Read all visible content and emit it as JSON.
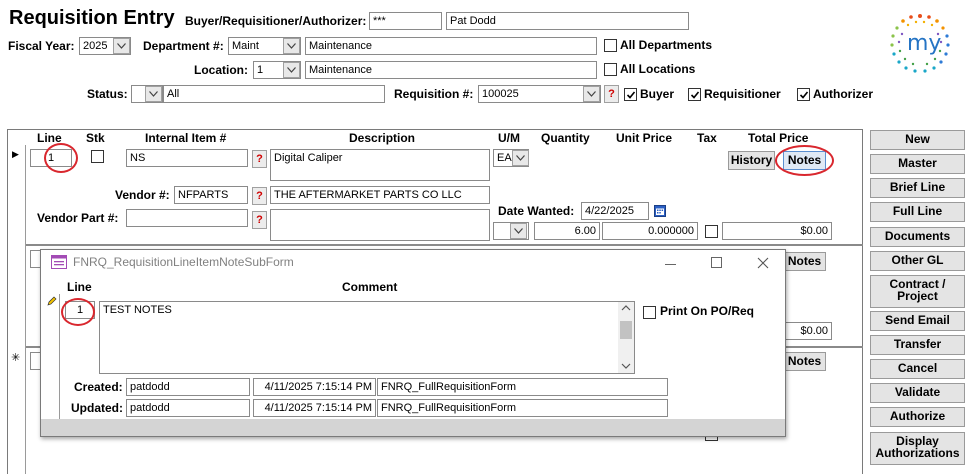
{
  "header": {
    "title": "Requisition Entry",
    "buyer_label": "Buyer/Requisitioner/Authorizer:",
    "buyer_code": "***",
    "buyer_name": "Pat Dodd",
    "fiscal_year_label": "Fiscal Year:",
    "fiscal_year": "2025",
    "department_label": "Department #:",
    "department_code": "Maint",
    "department_name": "Maintenance",
    "all_departments_label": "All Departments",
    "location_label": "Location:",
    "location_code": "1",
    "location_name": "Maintenance",
    "all_locations_label": "All Locations",
    "status_label": "Status:",
    "status_value": "All",
    "requisition_label": "Requisition #:",
    "requisition_value": "100025",
    "buyer_check_label": "Buyer",
    "requisitioner_check_label": "Requisitioner",
    "authorizer_check_label": "Authorizer"
  },
  "grid": {
    "columns": {
      "line": "Line",
      "stk": "Stk",
      "internal_item": "Internal Item #",
      "description": "Description",
      "um": "U/M",
      "quantity": "Quantity",
      "unit_price": "Unit Price",
      "tax": "Tax",
      "total_price": "Total Price"
    },
    "row": {
      "line": "1",
      "item": "NS",
      "description": "Digital Caliper",
      "um": "EA",
      "history_label": "History",
      "notes_label": "Notes",
      "vendor_label": "Vendor #:",
      "vendor_code": "NFPARTS",
      "vendor_name": "THE AFTERMARKET PARTS CO LLC",
      "vendor_part_label": "Vendor Part #:",
      "date_wanted_label": "Date Wanted:",
      "date_wanted": "4/22/2025",
      "quantity": "6.00",
      "unit_price": "0.000000",
      "total_price": "$0.00"
    },
    "row2": {
      "notes_label": "Notes",
      "total_price": "$0.00"
    },
    "row3": {
      "notes_label": "Notes"
    },
    "help_glyph": "?",
    "record_selector_glyph": "▶",
    "new_record_glyph": "✳"
  },
  "side_buttons": [
    "New",
    "Master",
    "Brief Line",
    "Full Line",
    "Documents",
    "Other GL",
    "Contract /\nProject",
    "Send Email",
    "Transfer",
    "Cancel",
    "Validate",
    "Authorize",
    "Display\nAuthorizations"
  ],
  "logo": {
    "text": "my"
  },
  "popup": {
    "title": "FNRQ_RequisitionLineItemNoteSubForm",
    "col_line": "Line",
    "col_comment": "Comment",
    "line": "1",
    "comment": "TEST NOTES",
    "print_label": "Print On PO/Req",
    "created_label": "Created:",
    "created_user": "patdodd",
    "created_date": "4/11/2025 7:15:14 PM",
    "created_form": "FNRQ_FullRequisitionForm",
    "updated_label": "Updated:",
    "updated_user": "patdodd",
    "updated_date": "4/11/2025 7:15:14 PM",
    "updated_form": "FNRQ_FullRequisitionForm"
  },
  "colors": {
    "annotation_ring": "#d9272e",
    "help_red": "#d00000"
  }
}
